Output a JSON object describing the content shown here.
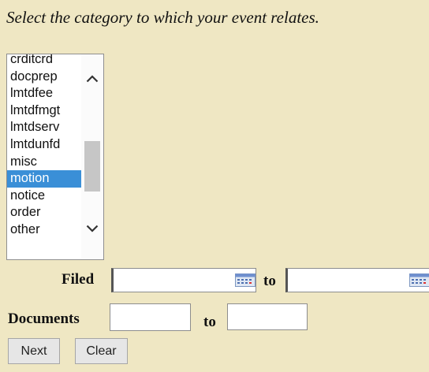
{
  "instruction": "Select the category to which your event relates.",
  "category_list": {
    "items": [
      "crditcrd",
      "docprep",
      "lmtdfee",
      "lmtdfmgt",
      "lmtdserv",
      "lmtdunfd",
      "misc",
      "motion",
      "notice",
      "order",
      "other"
    ],
    "selected": "motion"
  },
  "filed": {
    "label": "Filed",
    "from_value": "",
    "to_label": "to",
    "to_value": ""
  },
  "documents": {
    "label": "Documents",
    "from_value": "",
    "to_label": "to",
    "to_value": ""
  },
  "buttons": {
    "next": "Next",
    "clear": "Clear"
  },
  "icons": {
    "scroll_up": "chevron-up-icon",
    "scroll_down": "chevron-down-icon",
    "calendar": "calendar-icon"
  },
  "colors": {
    "background": "#efe7c3",
    "selection": "#3a8fd7"
  }
}
